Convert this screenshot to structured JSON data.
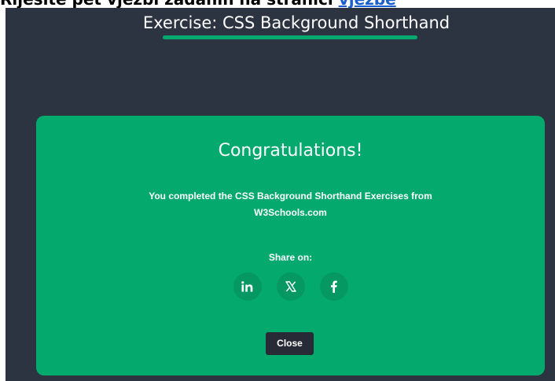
{
  "page_heading": {
    "text": "Riješite pet vježbi zadanih na stranici ",
    "link_text": "vježbe"
  },
  "exercise": {
    "title": "Exercise: CSS Background Shorthand"
  },
  "modal": {
    "title": "Congratulations!",
    "message_line1": "You completed the CSS Background Shorthand Exercises from",
    "message_line2": "W3Schools.com",
    "share_label": "Share on:",
    "share_buttons": [
      {
        "network": "linkedin",
        "icon": "linkedin-icon"
      },
      {
        "network": "x",
        "icon": "x-icon"
      },
      {
        "network": "facebook",
        "icon": "facebook-icon"
      }
    ],
    "close_label": "Close"
  },
  "colors": {
    "dark_background": "#2c3341",
    "accent_green": "#04aa6d",
    "icon_circle": "#059862",
    "close_button": "#282a35",
    "link": "#1a5fd0"
  }
}
